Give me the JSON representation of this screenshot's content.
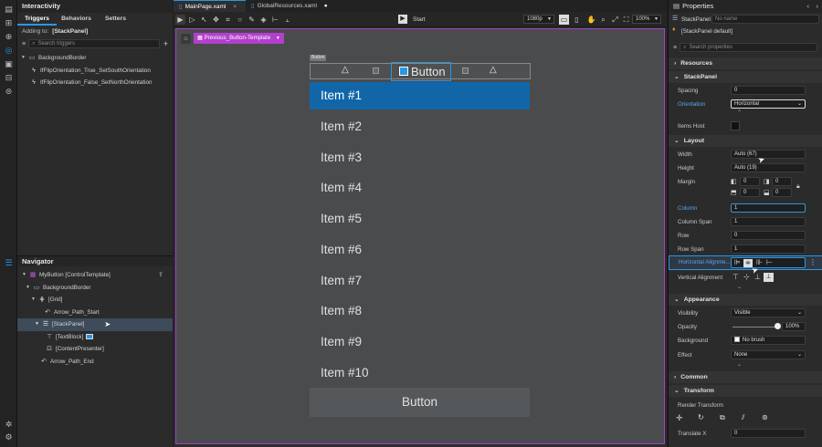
{
  "left_panel": {
    "title": "Interactivity",
    "tabs": [
      "Triggers",
      "Behaviors",
      "Setters"
    ],
    "adding_to_label": "Adding to:",
    "adding_to_value": "[StackPanel]",
    "search_placeholder": "Search triggers",
    "triggers": [
      "BackgroundBorder",
      "IfFlipOrientation_True_SetSouthOrientation",
      "IfFlipOrientation_False_SetNorthOrientation"
    ]
  },
  "navigator": {
    "title": "Navigator",
    "items": [
      "MyButton [ControlTemplate]",
      "BackgroundBorder",
      "[Grid]",
      "Arrow_Path_Start",
      "[StackPanel]",
      "[TextBlock]",
      "[ContentPresenter]",
      "Arrow_Path_End"
    ]
  },
  "doc_tabs": [
    "MainPage.xaml",
    "GlobalResources.xaml"
  ],
  "toolbar": {
    "start_label": "Start",
    "resolution": "1080p",
    "zoom": "100%"
  },
  "canvas": {
    "template_label": "Previous_Button-Template",
    "button_tag": "Button",
    "button_top_label": "Button",
    "items": [
      "Item #1",
      "Item #2",
      "Item #3",
      "Item #4",
      "Item #5",
      "Item #6",
      "Item #7",
      "Item #8",
      "Item #9",
      "Item #10"
    ],
    "button_bottom_label": "Button"
  },
  "properties": {
    "title": "Properties",
    "element_type": "StackPanel",
    "name_placeholder": "No name",
    "style_label": "[StackPanel default]",
    "search_placeholder": "Search properties",
    "sections": [
      "Resources",
      "StackPanel",
      "Layout",
      "Appearance",
      "Common",
      "Transform"
    ],
    "rows": {
      "spacing": {
        "label": "Spacing",
        "value": "0"
      },
      "orientation": {
        "label": "Orientation",
        "value": "Horizontal"
      },
      "items_host": {
        "label": "Items Host"
      },
      "width": {
        "label": "Width",
        "value": "Auto (67)"
      },
      "height": {
        "label": "Height",
        "value": "Auto (19)"
      },
      "margin": {
        "label": "Margin",
        "values": [
          "0",
          "0",
          "0",
          "0"
        ]
      },
      "column": {
        "label": "Column",
        "value": "1"
      },
      "column_span": {
        "label": "Column Span",
        "value": "1"
      },
      "row": {
        "label": "Row",
        "value": "0"
      },
      "row_span": {
        "label": "Row Span",
        "value": "1"
      },
      "horizontal_alignment": {
        "label": "Horizontal Alignme..."
      },
      "vertical_alignment": {
        "label": "Vertical Alignment"
      },
      "visibility": {
        "label": "Visibility",
        "value": "Visible"
      },
      "opacity": {
        "label": "Opacity",
        "value": "100%",
        "level": 1.0
      },
      "background": {
        "label": "Background",
        "value": "No brush"
      },
      "effect": {
        "label": "Effect",
        "value": "None"
      },
      "render_transform": {
        "label": "Render Transform"
      },
      "translate_x": {
        "label": "Translate X",
        "value": "0"
      }
    }
  }
}
